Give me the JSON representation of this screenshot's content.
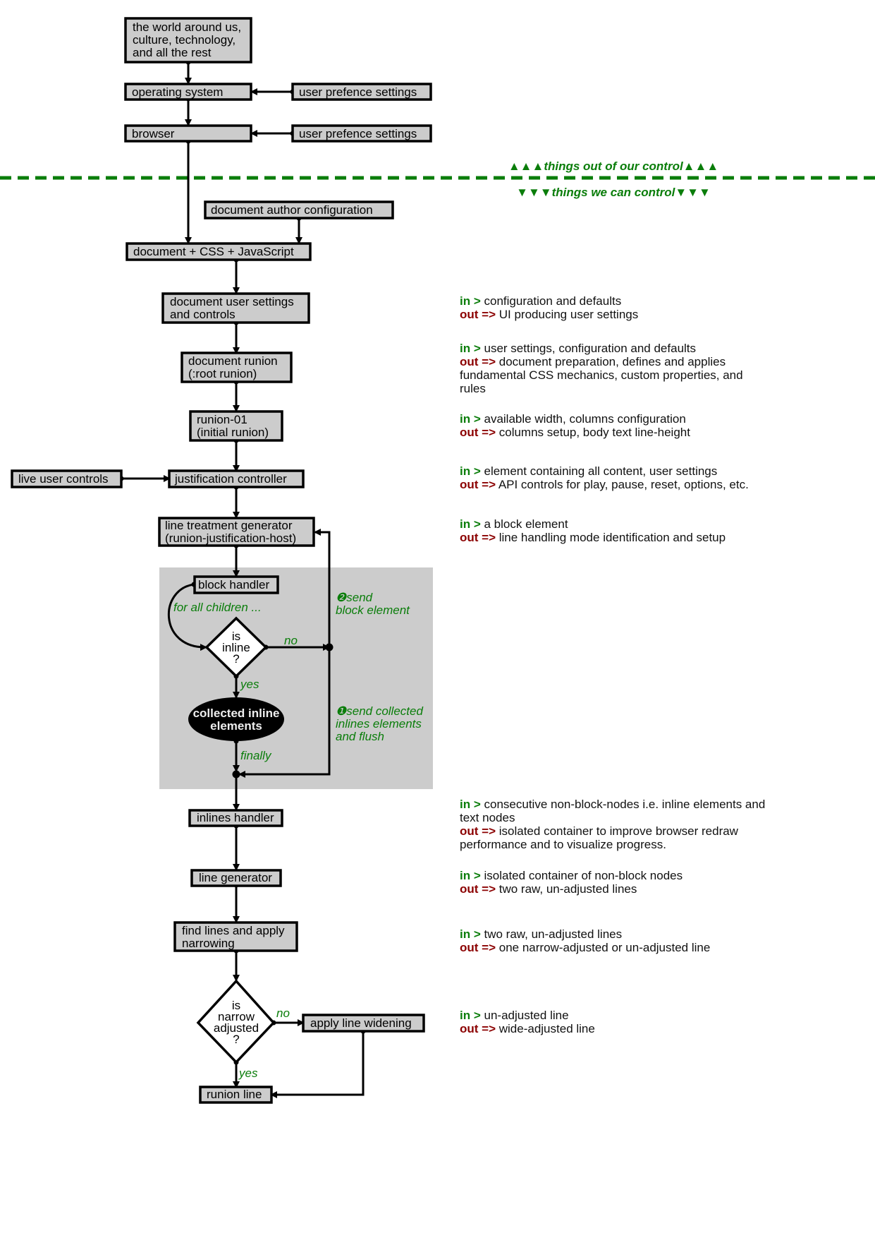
{
  "top_section": {
    "world": [
      "the world around us,",
      "culture, technology,",
      "and all the rest"
    ],
    "os": "operating system",
    "browser": "browser",
    "user_pref_1": "user prefence settings",
    "user_pref_2": "user prefence settings"
  },
  "divider": {
    "above": "▲▲▲things out of our control▲▲▲",
    "below": "▼▼▼things we can control▼▼▼",
    "color": "#0a7d0a"
  },
  "nodes": {
    "author_config": "document author configuration",
    "doc_css_js": "document + CSS + JavaScript",
    "user_settings": [
      "document user settings",
      "and controls"
    ],
    "doc_runion": [
      "document runion",
      "(:root runion)"
    ],
    "runion01": [
      "runion-01",
      "(initial runion)"
    ],
    "live_controls": "live user controls",
    "justification_controller": "justification controller",
    "line_treatment": [
      "line treatment generator",
      "(runion-justification-host)"
    ],
    "block_handler": "block handler",
    "for_all_children": "for all children ...",
    "is_inline": [
      "is",
      "inline",
      "?"
    ],
    "no_1": "no",
    "yes_1": "yes",
    "collected": [
      "collected inline",
      "elements"
    ],
    "finally": "finally",
    "send_block": [
      "❷send",
      "block element"
    ],
    "send_collected": [
      "❶send collected",
      "inlines elements",
      "and flush"
    ],
    "inlines_handler": "inlines handler",
    "line_generator": "line generator",
    "find_lines": [
      "find lines and apply",
      "narrowing"
    ],
    "is_narrow": [
      "is",
      "narrow",
      "adjusted",
      "?"
    ],
    "no_2": "no",
    "yes_2": "yes",
    "apply_widening": "apply line widening",
    "runion_line": "runion line"
  },
  "notes": [
    {
      "in_label": "in >",
      "in": "configuration and defaults",
      "out_label": "out =>",
      "out": "UI producing user settings"
    },
    {
      "in_label": "in >",
      "in": "user settings, configuration and defaults",
      "out_label": "out =>",
      "out": "document preparation, defines and applies fundamental CSS mechanics, custom properties, and rules"
    },
    {
      "in_label": "in >",
      "in": "available width, columns configuration",
      "out_label": "out =>",
      "out": "columns setup, body text line-height"
    },
    {
      "in_label": "in >",
      "in": "element containing all content, user settings",
      "out_label": "out =>",
      "out": "API controls for play, pause, reset, options, etc."
    },
    {
      "in_label": "in >",
      "in": "a block element",
      "out_label": "out =>",
      "out": "line handling mode identification and setup"
    },
    {
      "in_label": "in >",
      "in": "consecutive non-block-nodes i.e. inline elements and text nodes",
      "out_label": "out =>",
      "out": "isolated container to improve browser redraw performance and to visualize progress."
    },
    {
      "in_label": "in >",
      "in": "isolated container of non-block nodes",
      "out_label": "out =>",
      "out": "two raw, un-adjusted lines"
    },
    {
      "in_label": "in >",
      "in": "two raw, un-adjusted lines",
      "out_label": "out =>",
      "out": "one narrow-adjusted or un-adjusted line"
    },
    {
      "in_label": "in >",
      "in": "un-adjusted line",
      "out_label": "out =>",
      "out": "wide-adjusted line"
    }
  ]
}
